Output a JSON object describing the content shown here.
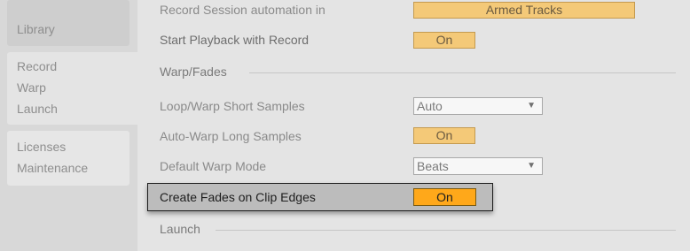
{
  "sidebar": {
    "items": [
      {
        "label": "Library"
      },
      {
        "label": "Record"
      },
      {
        "label": "Warp"
      },
      {
        "label": "Launch"
      },
      {
        "label": "Licenses"
      },
      {
        "label": "Maintenance"
      }
    ]
  },
  "record": {
    "session_automation_label": "Record Session automation in",
    "session_automation_value": "Armed Tracks",
    "start_playback_label": "Start Playback with Record",
    "start_playback_value": "On"
  },
  "warp_fades": {
    "title": "Warp/Fades",
    "loop_warp_label": "Loop/Warp Short Samples",
    "loop_warp_value": "Auto",
    "auto_warp_label": "Auto-Warp Long Samples",
    "auto_warp_value": "On",
    "default_warp_label": "Default Warp Mode",
    "default_warp_value": "Beats",
    "create_fades_label": "Create Fades on Clip Edges",
    "create_fades_value": "On"
  },
  "launch": {
    "title": "Launch"
  },
  "colors": {
    "toggle_on": "#f4c978",
    "toggle_active": "#ffa81a",
    "background": "#e4e4e4"
  }
}
